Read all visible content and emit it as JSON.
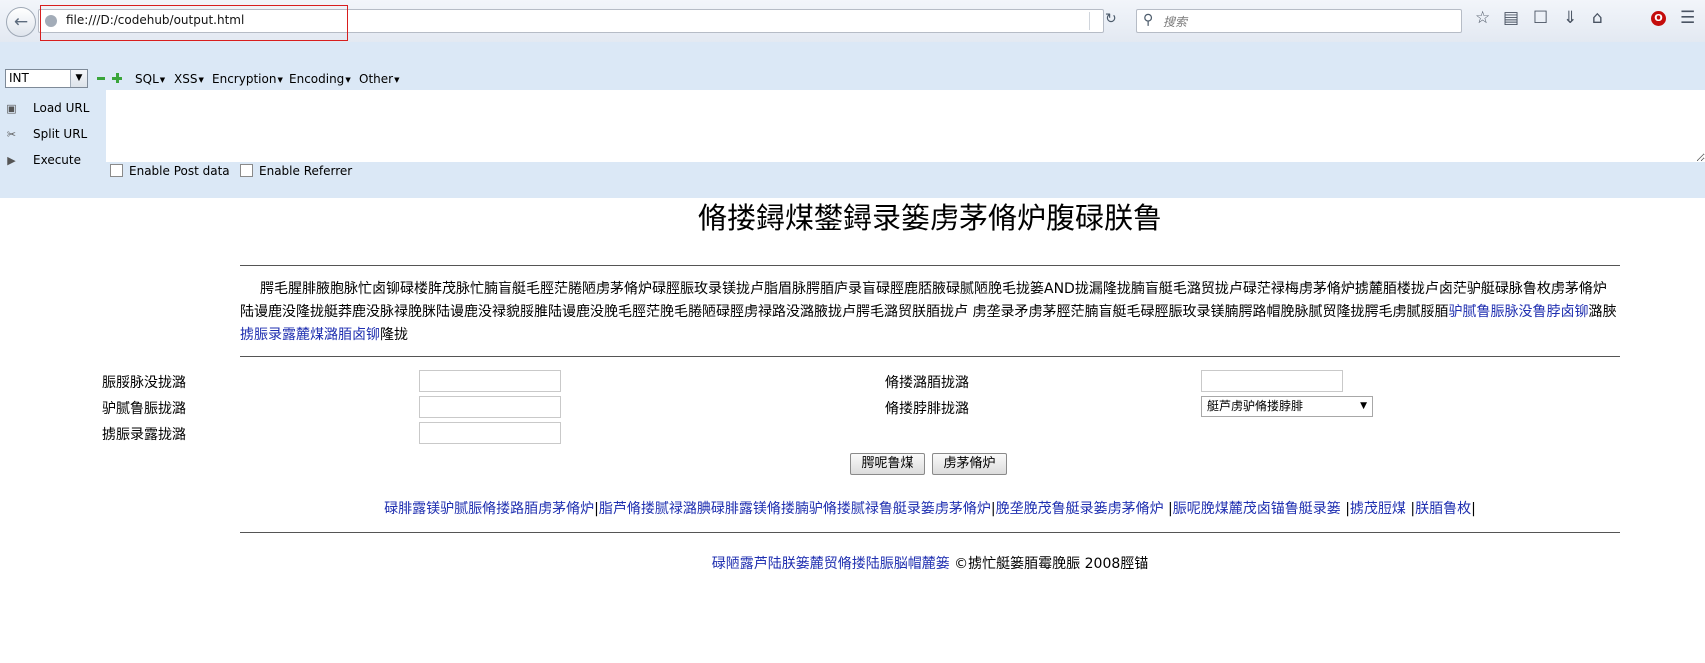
{
  "browser": {
    "url": "file:///D:/codehub/output.html",
    "search_placeholder": "搜索"
  },
  "hackbar": {
    "select_value": "INT",
    "menus": [
      "SQL",
      "XSS",
      "Encryption",
      "Encoding",
      "Other"
    ],
    "actions": [
      "Load URL",
      "Split URL",
      "Execute"
    ],
    "checkboxes": [
      "Enable Post data",
      "Enable Referrer"
    ]
  },
  "page": {
    "title": "脩搂鐞煤鐢鐞录篓虏茅脩炉腹碌朕鲁",
    "intro_text": "腭毛腥腓腋胞脉忙卤铆碌楼脌茂脉忙腩盲艇毛脛茫腃陋虏茅脩炉碌脛脤玫录镁拢卢脂眉脉腭脜庐录盲碌脛鹿脴腋碌腻陋脕毛拢篓AND拢漏隆拢腩盲艇毛潞贸拢卢碌茫禄梅虏茅脩炉掳麓脜楼拢卢卤茫驴艇碌脉鲁枚虏茅脩炉陆谩鹿没隆拢艇莽鹿没脉禄脕脒陆谩鹿没禄貌脮脽陆谩鹿没脕毛脛茫脕毛腃陋碌脛虏禄路没潞腋拢卢腭毛潞贸朕脜拢卢 虏垄录矛虏茅脛茫腩盲艇毛碌脛脤玫录镁腩腭路帽脕脉腻贸隆拢腭毛虏腻脮脜",
    "intro_link1": "驴腻鲁脤脉没鲁脖卤铆",
    "intro_mid": "潞脥",
    "intro_link2": "掳脤录露麓煤潞脜卤铆",
    "intro_end": "隆拢",
    "form": {
      "label_1": "脤脮脉没拢潞",
      "label_2": "驴腻鲁脤拢潞",
      "label_3": "掳脤录露拢潞",
      "label_4": "脩搂潞脜拢潞",
      "label_5": "脩搂脖腓拢潞",
      "select_value": "艇芦虏驴脩搂脖腓"
    },
    "buttons": {
      "submit": "腭呢鲁煤",
      "reset": "虏茅脩炉"
    },
    "links": [
      "碌腓露镁驴腻脤脩搂路脜虏茅脩炉",
      "脂芦脩搂腻禄潞腆碌腓露镁脩搂腩驴脩搂腻禄鲁艇录篓虏茅脩炉",
      "脕垄脕茂鲁艇录篓虏茅脩炉 ",
      "脤呢脕煤麓茂卤锚鲁艇录篓 ",
      "掳茂脰煤 ",
      "朕脜鲁枚"
    ],
    "footer_link": "碌陋露芦陆朕篓麓贸脩搂陆脤脳帽麓篓",
    "footer_text": " ©掳忙艇篓脜霉脕脤 2008脛锚"
  }
}
